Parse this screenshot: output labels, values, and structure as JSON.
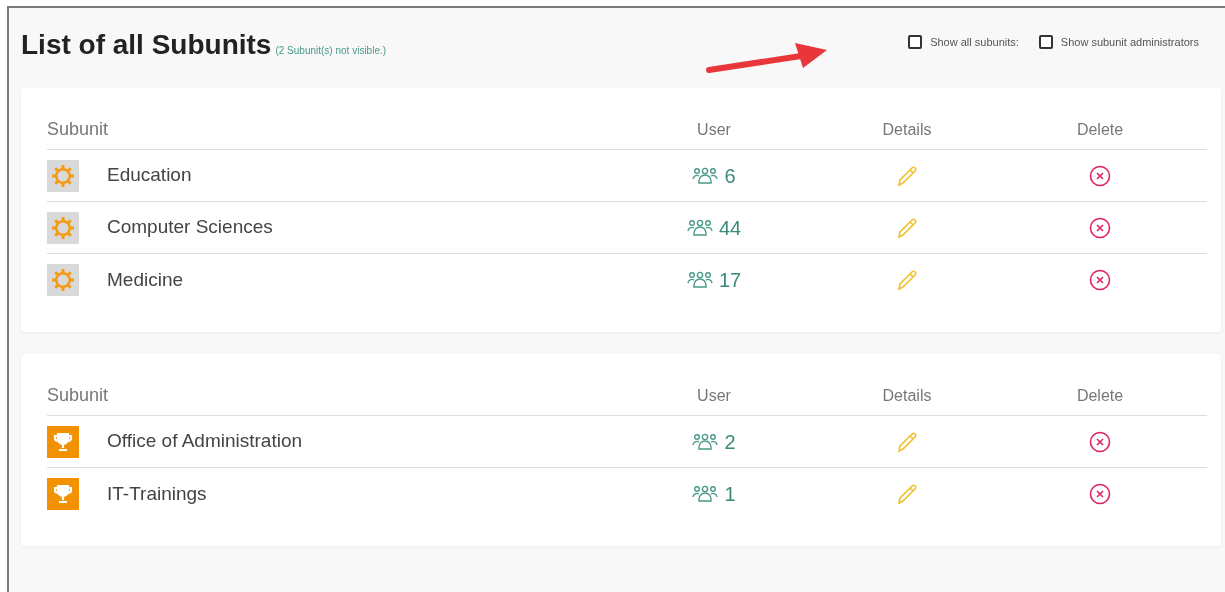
{
  "title": "List of all Subunits",
  "hidden_note": "(2 Subunit(s) not visible.)",
  "options": [
    {
      "label": "Show all subunits:",
      "checked": false
    },
    {
      "label": "Show subunit administrators",
      "checked": false
    }
  ],
  "tables": [
    {
      "columns": [
        "Subunit",
        "User",
        "Details",
        "Delete"
      ],
      "rows": [
        {
          "kind": "sun",
          "name": "Education",
          "users": "6"
        },
        {
          "kind": "sun",
          "name": "Computer Sciences",
          "users": "44"
        },
        {
          "kind": "sun",
          "name": "Medicine",
          "users": "17"
        }
      ]
    },
    {
      "columns": [
        "Subunit",
        "User",
        "Details",
        "Delete"
      ],
      "rows": [
        {
          "kind": "trophy",
          "name": "Office of Administration",
          "users": "2"
        },
        {
          "kind": "trophy",
          "name": "IT-Trainings",
          "users": "1"
        }
      ]
    }
  ]
}
